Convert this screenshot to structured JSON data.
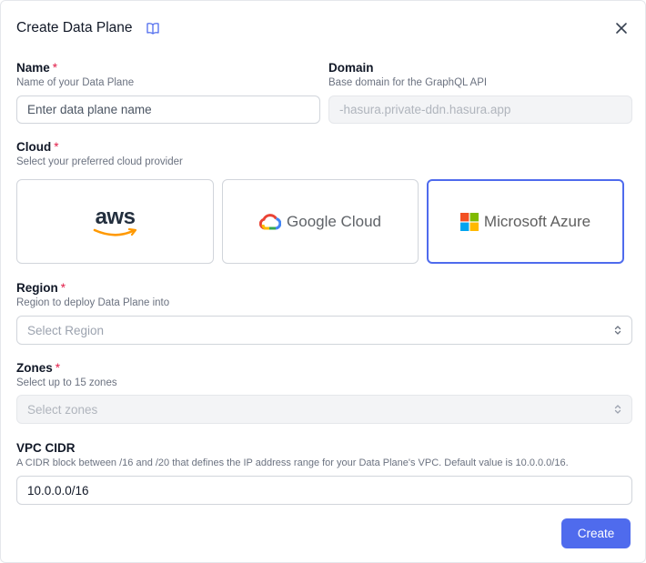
{
  "dialog": {
    "title": "Create Data Plane",
    "create_label": "Create"
  },
  "name": {
    "label": "Name",
    "required_mark": "*",
    "help": "Name of your Data Plane",
    "placeholder": "Enter data plane name"
  },
  "domain": {
    "label": "Domain",
    "help": "Base domain for the GraphQL API",
    "value": "-hasura.private-ddn.hasura.app"
  },
  "cloud": {
    "label": "Cloud",
    "required_mark": "*",
    "help": "Select your preferred cloud provider",
    "options": [
      {
        "label": "aws",
        "icon": "aws-smile-logo",
        "selected": false
      },
      {
        "label": "Google Cloud",
        "icon": "google-cloud-logo",
        "selected": false
      },
      {
        "label": "Microsoft Azure",
        "icon": "microsoft-logo",
        "selected": true
      }
    ]
  },
  "region": {
    "label": "Region",
    "required_mark": "*",
    "help": "Region to deploy Data Plane into",
    "placeholder": "Select Region"
  },
  "zones": {
    "label": "Zones",
    "required_mark": "*",
    "help": "Select up to 15 zones",
    "placeholder": "Select zones"
  },
  "vpc": {
    "label": "VPC CIDR",
    "help": "A CIDR block between /16 and /20 that defines the IP address range for your Data Plane's VPC. Default value is 10.0.0.0/16.",
    "value": "10.0.0.0/16"
  },
  "colors": {
    "accent": "#4f6bed",
    "required": "#e11d48"
  }
}
